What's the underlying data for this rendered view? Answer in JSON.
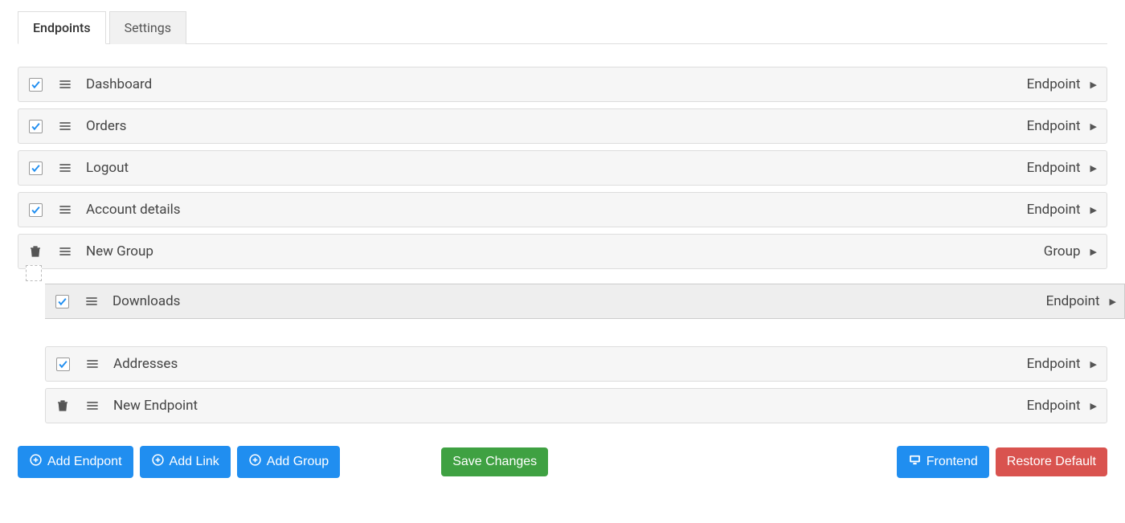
{
  "tabs": [
    {
      "label": "Endpoints",
      "active": true
    },
    {
      "label": "Settings",
      "active": false
    }
  ],
  "rows": [
    {
      "control": "check",
      "label": "Dashboard",
      "type": "Endpoint",
      "nested": false,
      "dragging": false
    },
    {
      "control": "check",
      "label": "Orders",
      "type": "Endpoint",
      "nested": false,
      "dragging": false
    },
    {
      "control": "check",
      "label": "Logout",
      "type": "Endpoint",
      "nested": false,
      "dragging": false
    },
    {
      "control": "check",
      "label": "Account details",
      "type": "Endpoint",
      "nested": false,
      "dragging": false
    },
    {
      "control": "trash",
      "label": "New Group",
      "type": "Group",
      "nested": false,
      "dragging": false
    },
    {
      "control": "check",
      "label": "Downloads",
      "type": "Endpoint",
      "nested": true,
      "dragging": true
    },
    {
      "control": "check",
      "label": "Addresses",
      "type": "Endpoint",
      "nested": true,
      "dragging": false
    },
    {
      "control": "trash",
      "label": "New Endpoint",
      "type": "Endpoint",
      "nested": true,
      "dragging": false
    }
  ],
  "buttons": {
    "add_endpoint": "Add Endpont",
    "add_link": "Add Link",
    "add_group": "Add Group",
    "save": "Save Changes",
    "frontend": "Frontend",
    "restore": "Restore Default"
  }
}
